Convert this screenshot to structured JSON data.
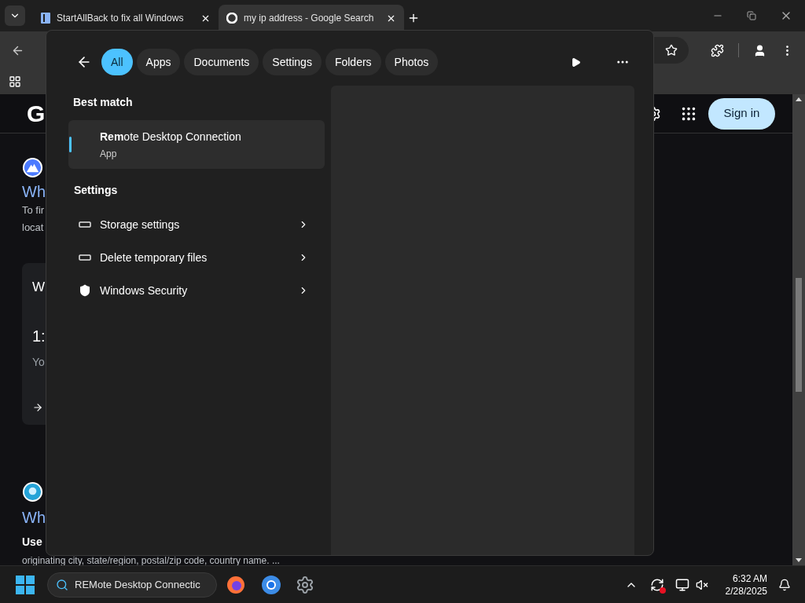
{
  "browser": {
    "tabs": [
      {
        "title": "StartAllBack to fix all Windows",
        "selected": false
      },
      {
        "title": "my ip address - Google Search",
        "selected": true
      }
    ],
    "page": {
      "logo_letter": "G",
      "sign_in": "Sign in",
      "result_1": {
        "link": "Wh",
        "snippet_lines": [
          "To fir",
          "locat"
        ]
      },
      "card": {
        "title": "W",
        "value": "1:",
        "caption": "Yo"
      },
      "result_2": {
        "link": "Wh",
        "bold": "Use",
        "snippet": "originating city, state/region, postal/zip code, country name. ..."
      }
    }
  },
  "search_flyout": {
    "filters": [
      {
        "label": "All",
        "selected": true
      },
      {
        "label": "Apps",
        "selected": false
      },
      {
        "label": "Documents",
        "selected": false
      },
      {
        "label": "Settings",
        "selected": false
      },
      {
        "label": "Folders",
        "selected": false
      },
      {
        "label": "Photos",
        "selected": false
      }
    ],
    "best_match_heading": "Best match",
    "best_match": {
      "title": "**Rem**ote Desktop Connection",
      "subtitle": "App",
      "selected": true
    },
    "settings_heading": "Settings",
    "settings_items": [
      {
        "label": "Storage settings",
        "kind": "storage"
      },
      {
        "label": "Delete temporary files",
        "kind": "storage"
      },
      {
        "label": "Windows Security",
        "kind": "security"
      }
    ]
  },
  "taskbar": {
    "search_value": "REMote Desktop Connectic",
    "time": "6:32 AM",
    "date": "2/28/2025"
  }
}
